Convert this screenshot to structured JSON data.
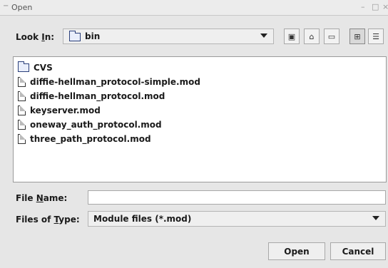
{
  "window": {
    "title": "Open",
    "menu_glyph": "−",
    "minimize_glyph": "–",
    "maximize_glyph": "□",
    "close_glyph": "×"
  },
  "look_in": {
    "label_pre": "Look ",
    "label_mnemonic": "I",
    "label_post": "n:",
    "value": "bin"
  },
  "toolbar": {
    "up_icon": "up-folder-icon",
    "home_icon": "home-icon",
    "new_folder_icon": "new-folder-icon",
    "list_view_icon": "list-view-icon",
    "details_view_icon": "details-view-icon"
  },
  "files": [
    {
      "name": "CVS",
      "kind": "folder"
    },
    {
      "name": "diffie-hellman_protocol-simple.mod",
      "kind": "file"
    },
    {
      "name": "diffie-hellman_protocol.mod",
      "kind": "file"
    },
    {
      "name": "keyserver.mod",
      "kind": "file"
    },
    {
      "name": "oneway_auth_protocol.mod",
      "kind": "file"
    },
    {
      "name": "three_path_protocol.mod",
      "kind": "file"
    }
  ],
  "file_name": {
    "label_pre": "File ",
    "label_mnemonic": "N",
    "label_post": "ame:",
    "value": ""
  },
  "file_type": {
    "label_pre": "Files of ",
    "label_mnemonic": "T",
    "label_post": "ype:",
    "value": "Module files (*.mod)"
  },
  "buttons": {
    "open": "Open",
    "cancel": "Cancel"
  }
}
